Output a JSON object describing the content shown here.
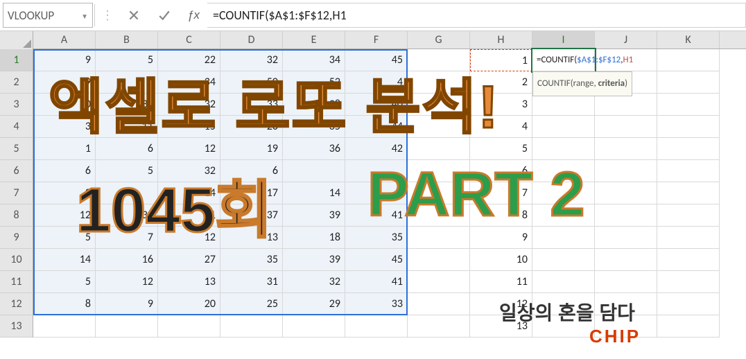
{
  "namebox": "VLOOKUP",
  "formula_text": "=COUNTIF($A$1:$F$12,H1",
  "columns": [
    "A",
    "B",
    "C",
    "D",
    "E",
    "F",
    "G",
    "H",
    "I",
    "J",
    "K"
  ],
  "grid": [
    [
      "9",
      "5",
      "22",
      "32",
      "34",
      "45",
      "",
      "1",
      "",
      "",
      ""
    ],
    [
      "9",
      "1",
      "34",
      "50",
      "52",
      "4",
      "",
      "2",
      "",
      "",
      ""
    ],
    [
      "20",
      "31",
      "32",
      "33",
      "38",
      "40",
      "",
      "3",
      "",
      "",
      ""
    ],
    [
      "3",
      "11",
      "15",
      "20",
      "35",
      "44",
      "",
      "4",
      "",
      "",
      ""
    ],
    [
      "1",
      "6",
      "12",
      "19",
      "36",
      "42",
      "",
      "5",
      "",
      "",
      ""
    ],
    [
      "6",
      "5",
      "32",
      "6",
      "",
      "",
      "",
      "6",
      "",
      "",
      ""
    ],
    [
      "2",
      "",
      "14",
      "17",
      "14",
      "",
      "",
      "7",
      "",
      "",
      ""
    ],
    [
      "12",
      "30",
      "31",
      "37",
      "39",
      "41",
      "",
      "8",
      "",
      "",
      ""
    ],
    [
      "5",
      "7",
      "12",
      "13",
      "18",
      "35",
      "",
      "9",
      "",
      "",
      ""
    ],
    [
      "14",
      "16",
      "27",
      "35",
      "39",
      "45",
      "",
      "10",
      "",
      "",
      ""
    ],
    [
      "5",
      "12",
      "13",
      "31",
      "32",
      "41",
      "",
      "11",
      "",
      "",
      ""
    ],
    [
      "8",
      "9",
      "20",
      "25",
      "29",
      "33",
      "",
      "12",
      "",
      "",
      ""
    ],
    [
      "",
      "",
      "",
      "",
      "",
      "",
      "",
      "13",
      "",
      "",
      ""
    ]
  ],
  "active_cell": {
    "row": 0,
    "col": 8,
    "prefix": "=COUNTIF(",
    "range": "$A$1:$F$12",
    "sep": ",",
    "crit": "H1"
  },
  "tooltip": {
    "fn": "COUNTIF(",
    "arg1": "range",
    "sep": ", ",
    "arg2bold": "criteria",
    "end": ")"
  },
  "overlay": {
    "title": "엑셀로 로또 분석!",
    "sub1": "1045회",
    "sub2": "PART 2",
    "foot1": "일상의 혼을 담다",
    "foot2": "CHIP"
  },
  "chart_data": {
    "type": "table",
    "note": "Excel sheet showing lotto-number data in A1:F12, lookup values 1..13 in column H, and a COUNTIF formula being entered in I1.",
    "formula": "=COUNTIF($A$1:$F$12,H1",
    "selection_range": "A1:F12",
    "criteria_cell": "H1",
    "active_cell": "I1"
  }
}
